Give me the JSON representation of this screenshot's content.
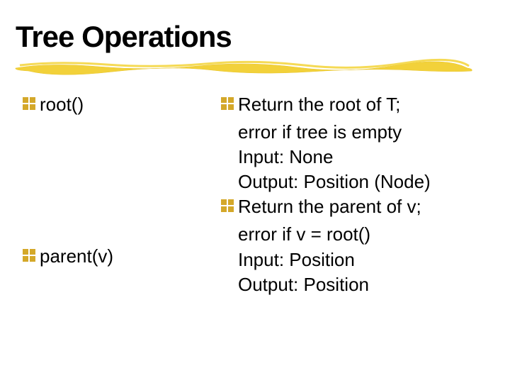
{
  "title": "Tree Operations",
  "left": {
    "item1": "root()",
    "item2": "parent(v)"
  },
  "right": {
    "b1_line1": "Return the root of T;",
    "b1_line2": "error if tree is empty",
    "b1_line3": "Input: None",
    "b1_line4": "Output: Position (Node)",
    "b2_line1": "Return the parent of v;",
    "b2_line2": "error if v = root()",
    "b2_line3": "Input: Position",
    "b2_line4": "Output: Position"
  }
}
